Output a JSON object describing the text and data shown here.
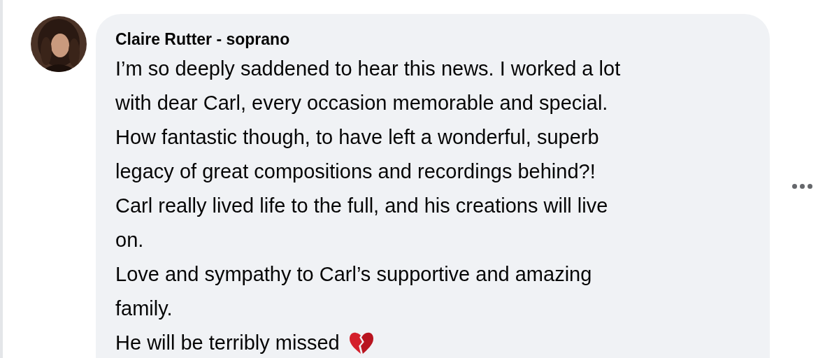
{
  "comment": {
    "author": "Claire Rutter - soprano",
    "lines": [
      "I’m so deeply saddened to hear this news. I worked a lot",
      "with dear Carl, every occasion memorable and special.",
      "How fantastic though, to have left a wonderful, superb",
      "legacy of great compositions and recordings behind?!",
      "Carl really lived life to the full, and his creations will live",
      "on.",
      "Love and sympathy to Carl’s supportive and amazing",
      "family.",
      "He will be terribly missed"
    ]
  }
}
